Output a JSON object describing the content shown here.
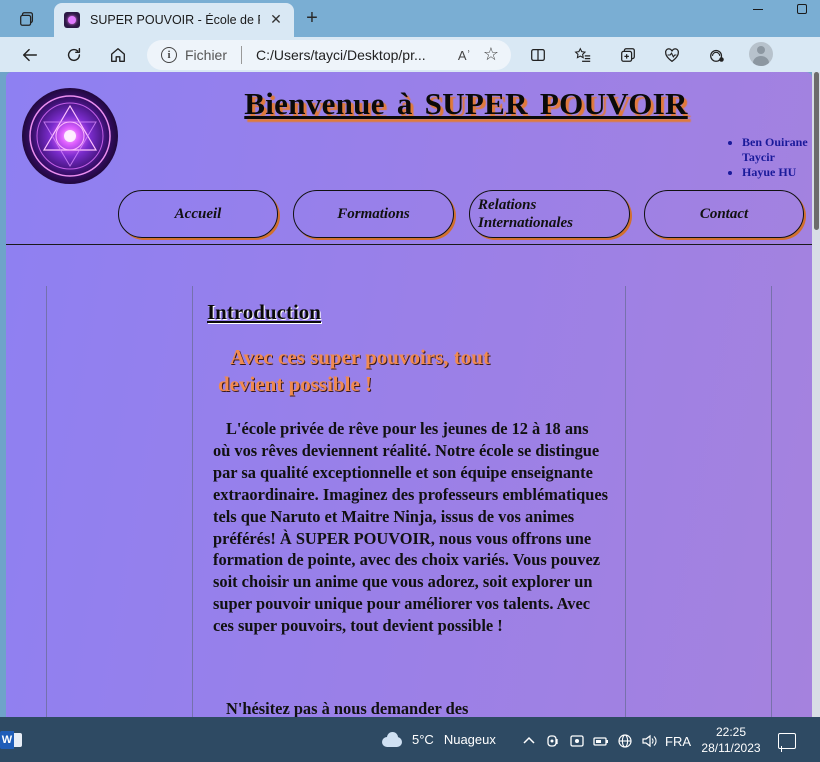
{
  "browser": {
    "tab_title": "SUPER POUVOIR - École de Rêve",
    "tab_close": "✕",
    "new_tab": "+",
    "address_scheme": "Fichier",
    "address_url": "C:/Users/tayci/Desktop/pr...",
    "read_aloud": "Aʾ"
  },
  "page": {
    "title": "Bienvenue  à  SUPER  POUVOIR",
    "authors": [
      "Ben Ouirane Taycir",
      "Hayue HU"
    ],
    "nav": [
      "Accueil",
      "Formations",
      "Relations Internationales",
      "Contact"
    ],
    "intro_heading": "Introduction",
    "tagline": "Avec ces super pouvoirs, tout devient possible !",
    "paragraph1": "L'école privée de rêve pour les jeunes de 12 à 18 ans où vos rêves deviennent réalité. Notre école se distingue par sa qualité exceptionnelle et son équipe enseignante extraordinaire. Imaginez des professeurs emblématiques tels que Naruto et Maitre Ninja, issus de vos animes préférés! À SUPER POUVOIR, nous vous offrons une formation de pointe, avec des choix variés. Vous pouvez soit choisir un anime que vous adorez, soit explorer un super pouvoir unique pour améliorer vos talents. Avec ces super pouvoirs, tout devient possible !",
    "paragraph2": "N'hésitez pas à nous demander des"
  },
  "taskbar": {
    "temperature": "5°C",
    "condition": "Nuageux",
    "language": "FRA",
    "time": "22:25",
    "date": "28/11/2023"
  },
  "colors": {
    "title_shadow": "#e07a3a",
    "tagline": "#f08a50",
    "authors": "#1a1a9a",
    "taskbar": "#2e4a63"
  }
}
